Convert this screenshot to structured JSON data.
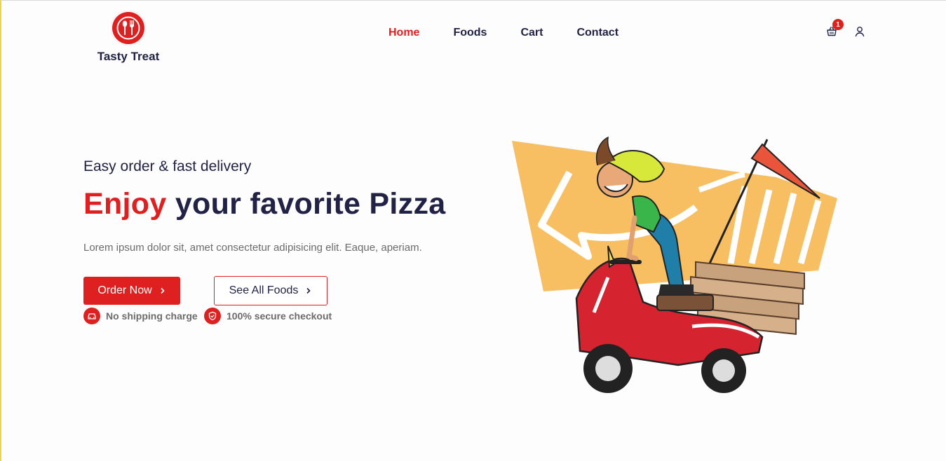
{
  "brand": {
    "name": "Tasty Treat",
    "color": "#df2020",
    "logo_icon": "spoon-fork-icon"
  },
  "nav": {
    "items": [
      {
        "label": "Home",
        "active": true
      },
      {
        "label": "Foods",
        "active": false
      },
      {
        "label": "Cart",
        "active": false
      },
      {
        "label": "Contact",
        "active": false
      }
    ],
    "cart_count": "1",
    "cart_icon": "shopping-basket-icon",
    "user_icon": "user-icon"
  },
  "hero": {
    "subtitle": "Easy order & fast delivery",
    "title_accent": "Enjoy",
    "title_rest": " your favorite Pizza",
    "description": "Lorem ipsum dolor sit, amet consectetur adipisicing elit. Eaque, aperiam.",
    "primary_button": "Order Now",
    "secondary_button": "See All Foods",
    "features": [
      {
        "icon": "car-icon",
        "label": "No shipping charge"
      },
      {
        "icon": "shield-check-icon",
        "label": "100% secure checkout"
      }
    ],
    "image": "delivery-scooter-illustration"
  }
}
